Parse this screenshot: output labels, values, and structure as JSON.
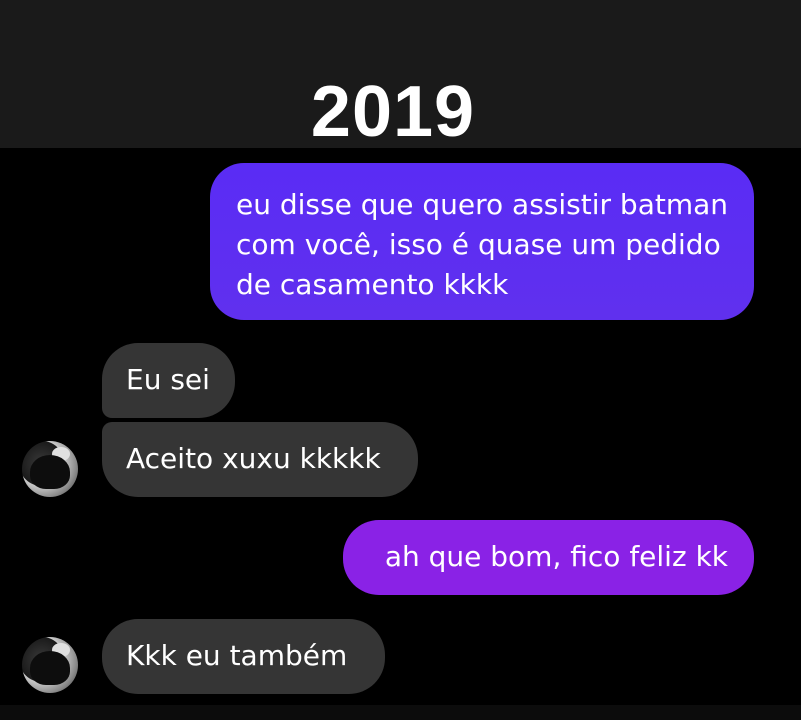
{
  "header": {
    "year": "2019"
  },
  "messages": {
    "sent_1": "eu disse que quero assistir batman com você, isso é quase um pedido de casamento kkkk",
    "received_1": "Eu sei",
    "received_2": "Aceito xuxu kkkkk",
    "sent_2": "ah que bom, fico feliz kk",
    "received_3": "Kkk eu também"
  },
  "colors": {
    "header_bg": "#1a1a1a",
    "chat_bg": "#000000",
    "sent_bubble_1": "#5a2cf5",
    "sent_bubble_2": "#8a22e6",
    "received_bubble": "#353535",
    "text": "#ffffff"
  },
  "icons": {
    "avatar": "contact-avatar"
  }
}
